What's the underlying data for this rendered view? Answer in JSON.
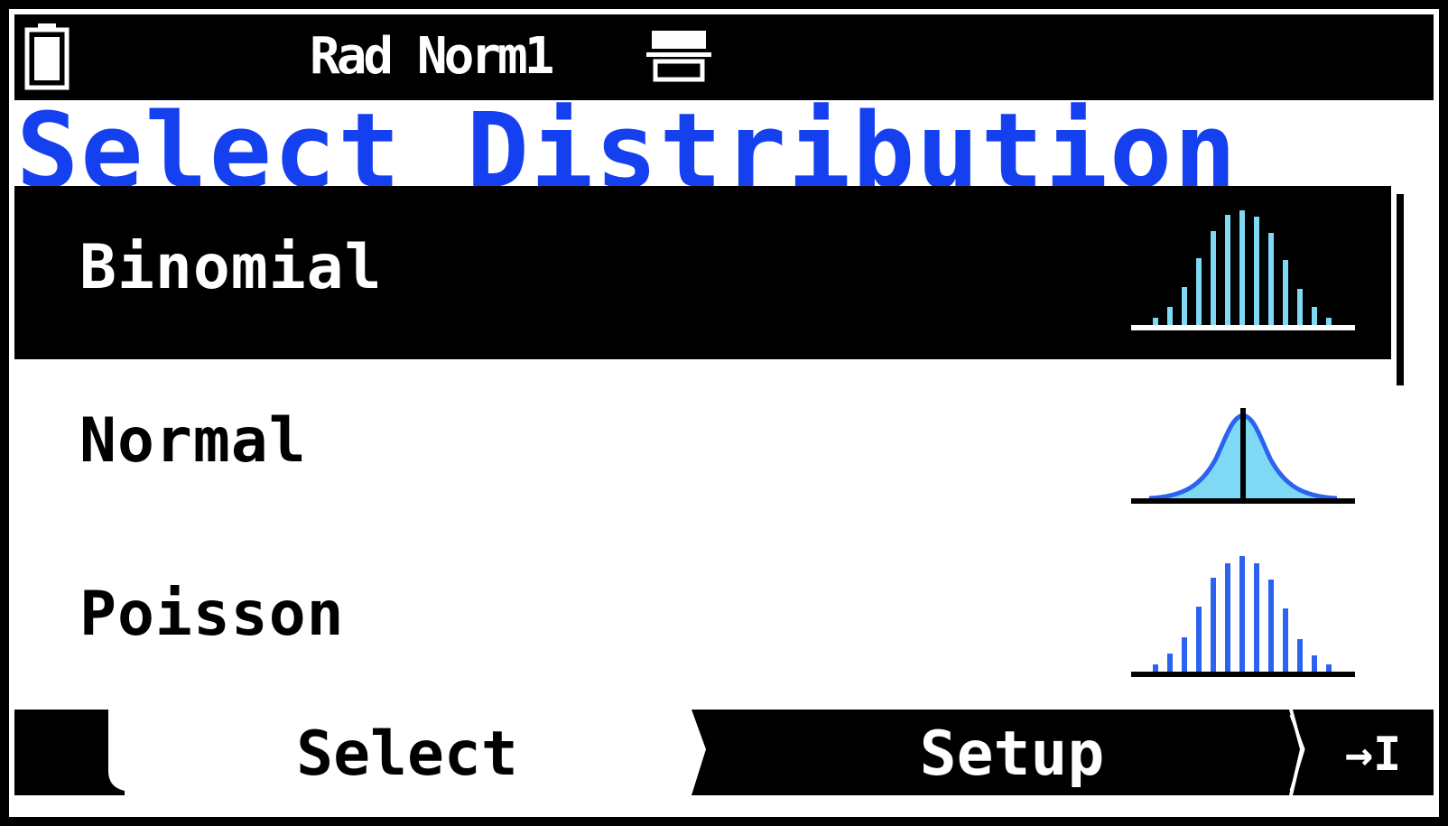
{
  "status_bar": {
    "mode": "Rad Norm1",
    "battery_icon": "battery-icon",
    "keyboard_icon": "keyboard-icon"
  },
  "title": "Select Distribution",
  "distributions": [
    {
      "label": "Binomial",
      "icon": "binomial-distribution-icon",
      "selected": true
    },
    {
      "label": "Normal",
      "icon": "normal-distribution-icon",
      "selected": false
    },
    {
      "label": "Poisson",
      "icon": "poisson-distribution-icon",
      "selected": false
    }
  ],
  "function_keys": {
    "f1": "",
    "f2": "Select",
    "f3": "Setup",
    "f4": "→I"
  },
  "colors": {
    "title": "#1540f0",
    "binomial_bars": "#7fd8f4",
    "normal_fill": "#7fd8f4",
    "normal_curve": "#2b63f0",
    "poisson_bars": "#2b63f0"
  }
}
